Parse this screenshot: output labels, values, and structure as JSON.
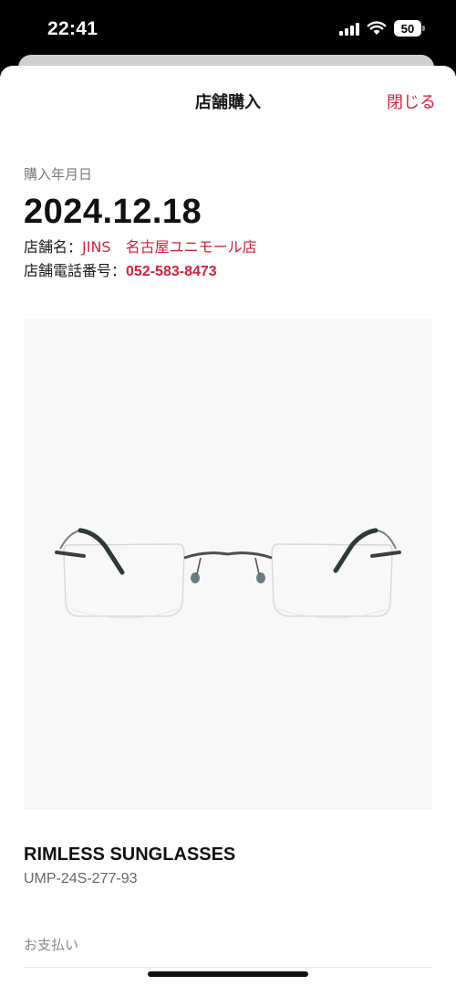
{
  "status_bar": {
    "time": "22:41",
    "battery_level": "50",
    "icons": [
      "signal-icon",
      "wifi-icon",
      "battery-icon"
    ]
  },
  "header": {
    "title": "店舗購入",
    "close_label": "閉じる"
  },
  "purchase": {
    "date_label": "購入年月日",
    "date": "2024.12.18",
    "store_name_label": "店舗名：",
    "store_name": "JINS　名古屋ユニモール店",
    "store_phone_label": "店舗電話番号：",
    "store_phone": "052-583-8473"
  },
  "product": {
    "name": "RIMLESS SUNGLASSES",
    "code": "UMP-24S-277-93"
  },
  "payment": {
    "label": "お支払い"
  },
  "colors": {
    "accent_red": "#d8203a",
    "image_bg": "#f8f8f8"
  }
}
